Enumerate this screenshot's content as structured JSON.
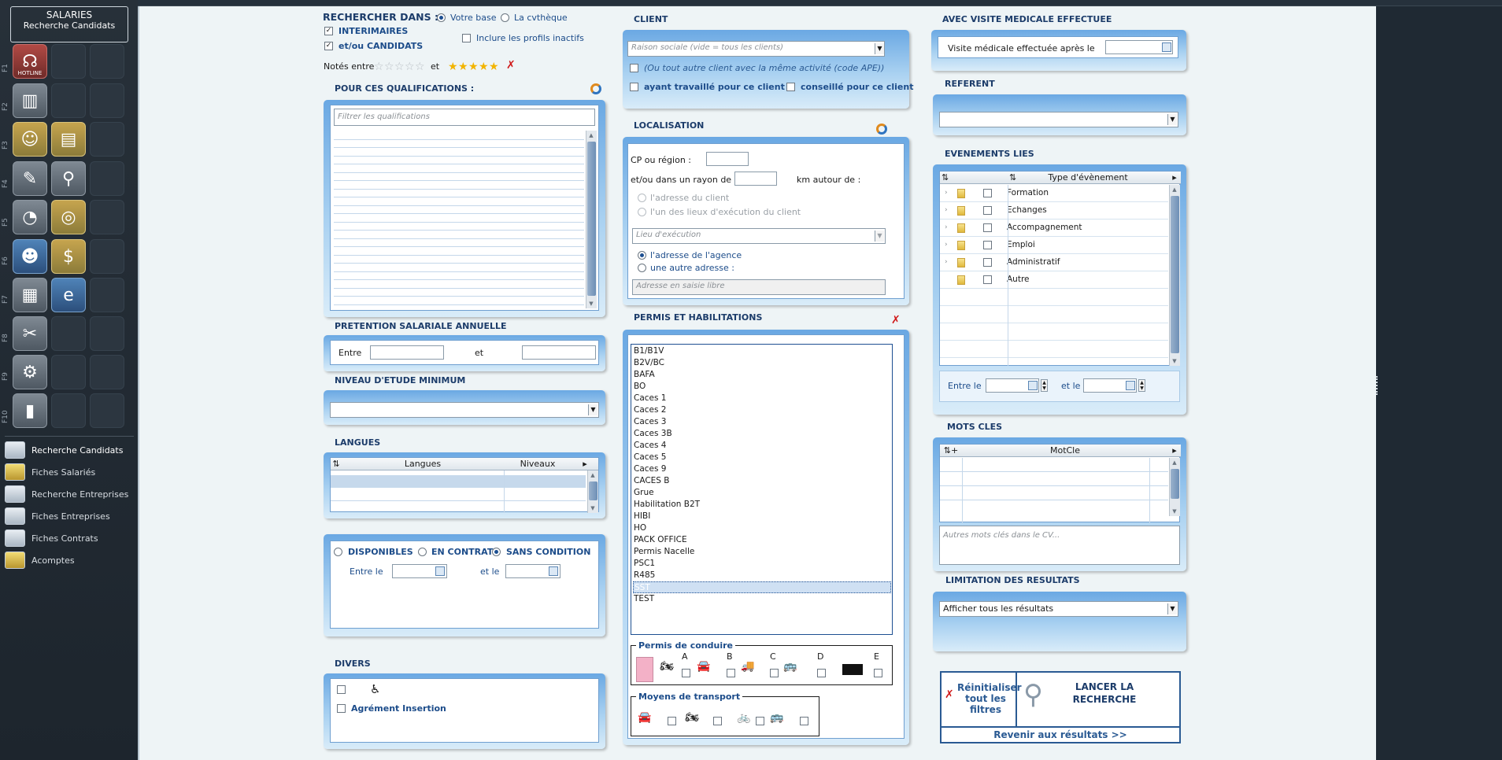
{
  "sidebar": {
    "header_title": "SALARIES",
    "header_subtitle": "Recherche Candidats",
    "fkeys": [
      "F1",
      "F2",
      "F3",
      "F4",
      "F5",
      "F6",
      "F7",
      "F8",
      "F9",
      "F10"
    ],
    "hotline": "HOTLINE",
    "nav": [
      {
        "label": "Recherche Candidats",
        "icon": "search-document-icon"
      },
      {
        "label": "Fiches Salariés",
        "icon": "employee-card-icon"
      },
      {
        "label": "Recherche Entreprises",
        "icon": "search-company-icon"
      },
      {
        "label": "Fiches Entreprises",
        "icon": "company-card-icon"
      },
      {
        "label": "Fiches Contrats",
        "icon": "contract-card-icon"
      },
      {
        "label": "Acomptes",
        "icon": "coins-icon"
      }
    ]
  },
  "search": {
    "title": "RECHERCHER DANS :",
    "radio_base": "Votre base",
    "radio_cvtheque": "La cvthèque",
    "interimaires": "INTERIMAIRES",
    "candidats": "et/ou CANDIDATS",
    "inactifs": "Inclure les profils inactifs",
    "notes_label": "Notés entre",
    "notes_et": "et",
    "min_stars": 0,
    "max_stars": 5
  },
  "qualifications": {
    "title": "POUR CES QUALIFICATIONS :",
    "filter_placeholder": "Filtrer les qualifications"
  },
  "salary": {
    "title": "PRETENTION SALARIALE ANNUELLE",
    "entre": "Entre",
    "et": "et"
  },
  "etude": {
    "title": "NIVEAU D'ETUDE MINIMUM",
    "value": ""
  },
  "langues": {
    "title": "LANGUES",
    "col_langues": "Langues",
    "col_niveaux": "Niveaux"
  },
  "dispo": {
    "disponibles": "DISPONIBLES",
    "en_contrat": "EN CONTRAT",
    "sans_condition": "SANS CONDITION",
    "entre_le": "Entre le",
    "et_le": "et le"
  },
  "divers": {
    "title": "DIVERS",
    "agrement": "Agrément Insertion"
  },
  "client": {
    "title": "CLIENT",
    "placeholder": "Raison sociale (vide = tous les clients)",
    "ape": "(Ou tout autre client avec la même activité (code APE))",
    "travaille": "ayant travaillé pour ce client",
    "conseille": "conseillé pour ce client"
  },
  "localisation": {
    "title": "LOCALISATION",
    "cp": "CP ou région :",
    "rayon": "et/ou dans un rayon de",
    "km": "km autour de :",
    "adresse_client": "l'adresse du client",
    "lieux_exec": "l'un des lieux d'exécution du client",
    "lieu_placeholder": "Lieu d'exécution",
    "adresse_agence": "l'adresse de l'agence",
    "autre_adresse": "une autre adresse :",
    "saisie_placeholder": "Adresse en saisie libre"
  },
  "permis": {
    "title": "PERMIS ET HABILITATIONS",
    "items": [
      "B1/B1V",
      "B2V/BC",
      "BAFA",
      "BO",
      "Caces 1",
      "Caces 2",
      "Caces 3",
      "Caces 3B",
      "Caces 4",
      "Caces 5",
      "Caces 9",
      "CACES B",
      "Grue",
      "Habilitation B2T",
      "HIBI",
      "HO",
      "PACK OFFICE",
      "Permis Nacelle",
      "PSC1",
      "R485",
      "SST",
      "TEST"
    ],
    "selected_index": 20,
    "conduire_title": "Permis de conduire",
    "classes": [
      "A",
      "B",
      "C",
      "D",
      "E"
    ],
    "transport_title": "Moyens de transport"
  },
  "visite": {
    "title": "AVEC VISITE MEDICALE EFFECTUEE",
    "label": "Visite médicale effectuée après le"
  },
  "referent": {
    "title": "REFERENT",
    "value": ""
  },
  "evenements": {
    "title": "EVENEMENTS LIES",
    "col_type": "Type d'évènement",
    "rows": [
      "Formation",
      "Echanges",
      "Accompagnement",
      "Emploi",
      "Administratif",
      "Autre"
    ],
    "entre_le": "Entre le",
    "et_le": "et le"
  },
  "mots": {
    "title": "MOTS CLES",
    "col": "MotCle",
    "placeholder": "Autres mots clés dans le CV..."
  },
  "limitation": {
    "title": "LIMITATION DES RESULTATS",
    "value": "Afficher tous les résultats"
  },
  "actions": {
    "reset": "Réinitialiser tout les filtres",
    "launch": "LANCER LA RECHERCHE",
    "back": "Revenir aux résultats >>"
  },
  "colors": {
    "accent": "#1c3c6a",
    "panel": "#7fb8ea",
    "sidebar": "#222c35"
  }
}
